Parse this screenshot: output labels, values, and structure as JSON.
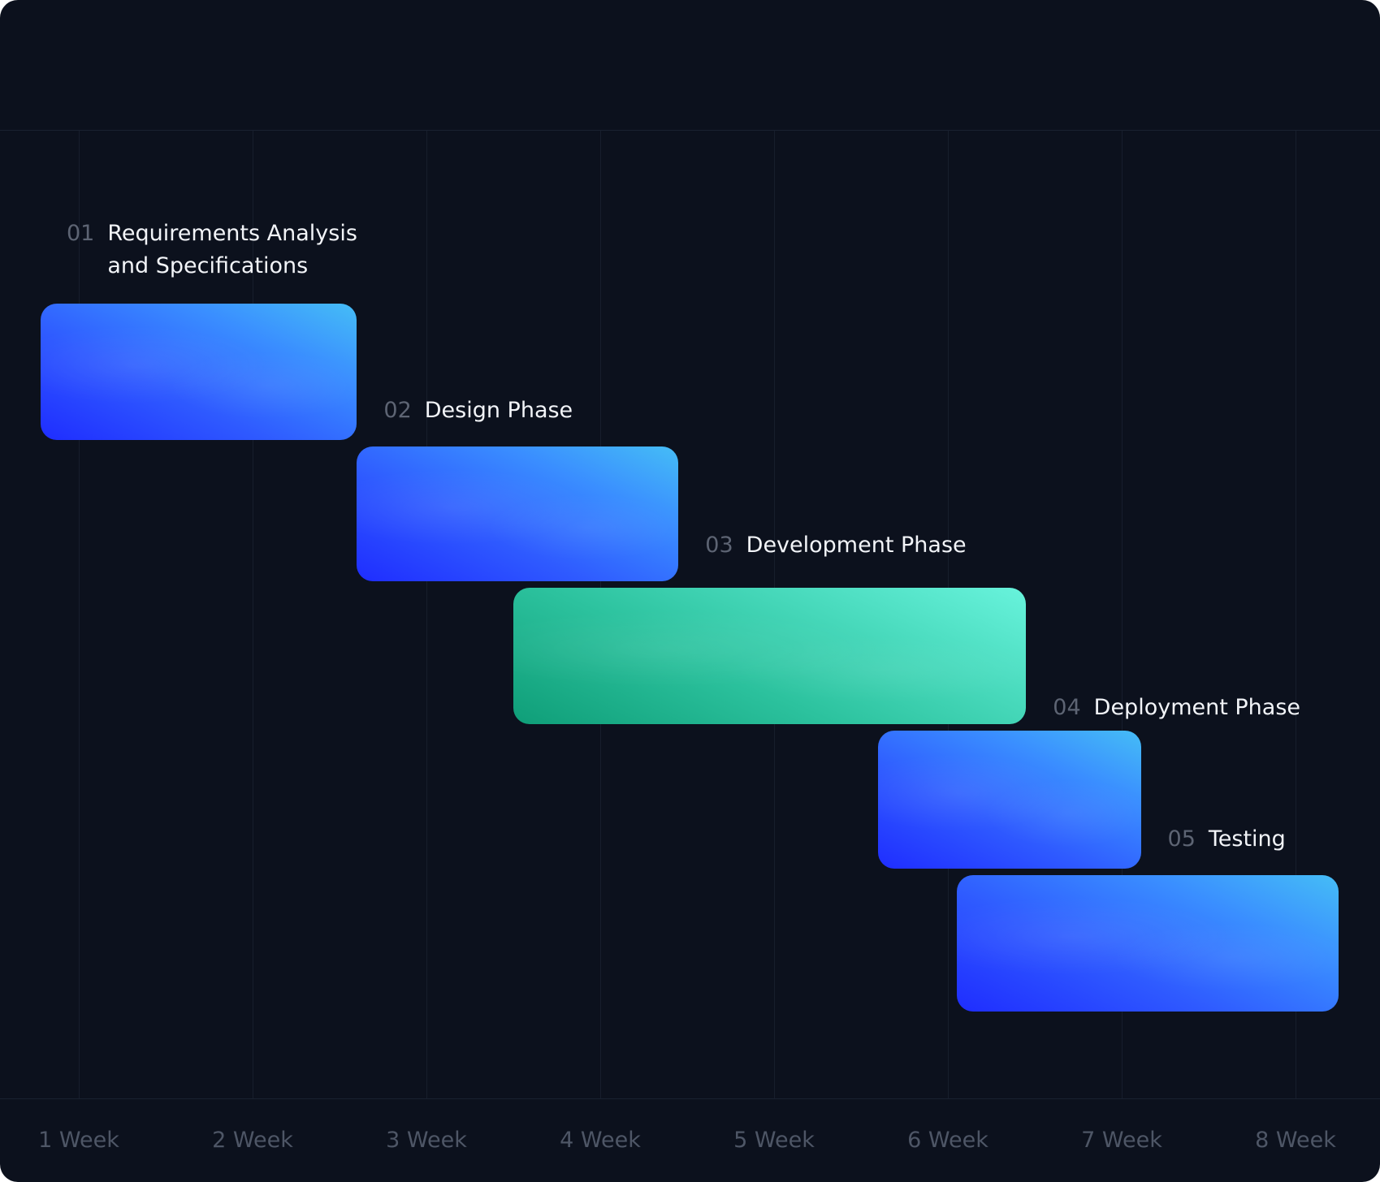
{
  "chart_data": {
    "type": "gantt",
    "x_axis": {
      "tick_labels": [
        "1 Week",
        "2 Week",
        "3 Week",
        "4 Week",
        "5 Week",
        "6 Week",
        "7 Week",
        "8 Week"
      ],
      "range": [
        0.5,
        8.5
      ],
      "grid": true
    },
    "tasks": [
      {
        "num": "01",
        "name": "Requirements Analysis",
        "name_line2": "and Specifications",
        "start": 0.78,
        "end": 2.6,
        "color": "blue"
      },
      {
        "num": "02",
        "name": "Design Phase",
        "start": 2.6,
        "end": 4.45,
        "color": "blue"
      },
      {
        "num": "03",
        "name": "Development Phase",
        "start": 3.5,
        "end": 6.45,
        "color": "green"
      },
      {
        "num": "04",
        "name": "Deployment Phase",
        "start": 5.6,
        "end": 7.11,
        "color": "blue"
      },
      {
        "num": "05",
        "name": "Testing",
        "start": 6.05,
        "end": 8.25,
        "color": "blue"
      }
    ]
  },
  "colors": {
    "background": "#0c111d",
    "blue_start": "#1f2dff",
    "blue_end": "#45bdf6",
    "green_start": "#0f9e78",
    "green_end": "#68f3dc",
    "task_number": "#5d6473",
    "task_name": "#f2f4f8",
    "tick_label": "#4e5666"
  }
}
